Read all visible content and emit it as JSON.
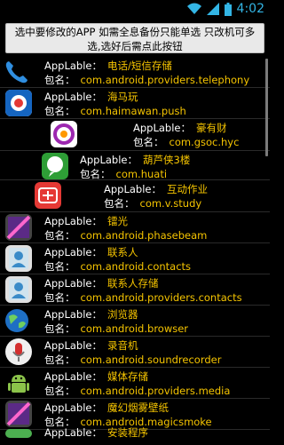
{
  "status": {
    "time": "4:02"
  },
  "notice": {
    "text": "选中要修改的APP 如需全息备份只能单选  只改机可多选,选好后需点此按钮"
  },
  "labels": {
    "app_label": "AppLable：",
    "package_label": "包名："
  },
  "apps": [
    {
      "name": "电话/短信存储",
      "package": "com.android.providers.telephony",
      "icon": "phone-icon"
    },
    {
      "name": "海马玩",
      "package": "com.haimawan.push",
      "icon": "haimawan-icon"
    },
    {
      "name": "豪有财",
      "package": "com.gsoc.hyc",
      "icon": "haoyoucai-icon"
    },
    {
      "name": "葫芦侠3楼",
      "package": "com.huati",
      "icon": "huluxia-icon"
    },
    {
      "name": "互动作业",
      "package": "com.v.study",
      "icon": "hudong-icon"
    },
    {
      "name": "镭光",
      "package": "com.android.phasebeam",
      "icon": "phasebeam-icon"
    },
    {
      "name": "联系人",
      "package": "com.android.contacts",
      "icon": "contacts-icon"
    },
    {
      "name": "联系人存储",
      "package": "com.android.providers.contacts",
      "icon": "contacts-storage-icon"
    },
    {
      "name": "浏览器",
      "package": "com.android.browser",
      "icon": "browser-icon"
    },
    {
      "name": "录音机",
      "package": "com.android.soundrecorder",
      "icon": "soundrecorder-icon"
    },
    {
      "name": "媒体存储",
      "package": "com.android.providers.media",
      "icon": "media-storage-icon"
    },
    {
      "name": "魔幻烟雾壁纸",
      "package": "com.android.magicsmoke",
      "icon": "magicsmoke-icon"
    },
    {
      "name": "安装程序",
      "package": "",
      "icon": "installer-icon"
    }
  ]
}
